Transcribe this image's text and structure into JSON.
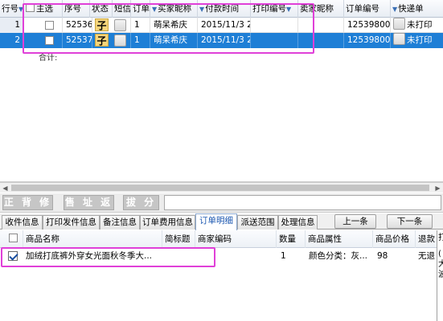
{
  "grid": {
    "headers": {
      "row_no": "行号",
      "select": "主选",
      "seq": "序号",
      "status": "状态",
      "sms": "短信",
      "order_count": "订单",
      "buyer_nick": "买家昵称",
      "pay_time": "付款时间",
      "print_no": "打印编号",
      "seller_nick": "卖家昵称",
      "order_no": "订单编号",
      "express": "快递单"
    },
    "rows": [
      {
        "row_no": "1",
        "seq": "52536",
        "status": "子",
        "order_count": "1",
        "buyer_nick": "萌呆希庆",
        "pay_time": "2015/11/3 2(",
        "order_no": "125398004",
        "express": "未打印"
      },
      {
        "row_no": "2",
        "seq": "52537",
        "status": "子",
        "order_count": "1",
        "buyer_nick": "萌呆希庆",
        "pay_time": "2015/11/3 2(",
        "order_no": "125398004",
        "express": "未打印"
      }
    ],
    "total_label": "合计:"
  },
  "toolbar": {
    "buttons": [
      "正 背 修",
      "售 址 返",
      "拔 分"
    ]
  },
  "tabs": {
    "items": [
      "收件信息",
      "打印发件信息",
      "备注信息",
      "订单费用信息",
      "订单明细",
      "派送范围",
      "处理信息"
    ],
    "active": "订单明细",
    "prev_label": "上一条",
    "next_label": "下一条"
  },
  "detail": {
    "headers": {
      "product_name": "商品名称",
      "short_title": "简标题",
      "merchant_code": "商家编码",
      "qty": "数量",
      "attr": "商品属性",
      "price": "商品价格",
      "refund": "退款"
    },
    "rows": [
      {
        "product_name": "加绒打底裤外穿女光面秋冬季大...",
        "qty": "1",
        "attr": "颜色分类：灰...",
        "price": "98",
        "refund": "无退"
      }
    ]
  },
  "right_panel": {
    "lines": [
      "打",
      "(",
      "大",
      "波"
    ]
  },
  "colors": {
    "selected_row": "#1e7fd6",
    "highlight_box": "#e040d8",
    "active_tab_text": "#1a56b0",
    "status_badge": "#f6d57a"
  }
}
